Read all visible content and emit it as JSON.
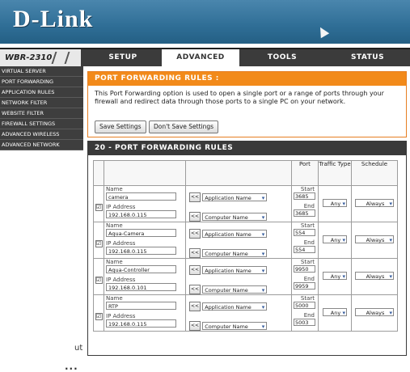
{
  "brand": {
    "logo": "D-Link"
  },
  "nav": {
    "model": "WBR-2310",
    "tabs": [
      {
        "label": "SETUP"
      },
      {
        "label": "ADVANCED"
      },
      {
        "label": "TOOLS"
      },
      {
        "label": "STATUS"
      }
    ],
    "active_tab": "ADVANCED"
  },
  "sidebar": {
    "items": [
      {
        "label": "Virtual Server"
      },
      {
        "label": "Port Forwarding"
      },
      {
        "label": "Application Rules"
      },
      {
        "label": "Network Filter"
      },
      {
        "label": "Website Filter"
      },
      {
        "label": "Firewall Settings"
      },
      {
        "label": "Advanced Wireless"
      },
      {
        "label": "Advanced Network"
      }
    ]
  },
  "fragments": {
    "text1": "ut",
    "text2": "..."
  },
  "intro": {
    "title": "PORT FORWARDING RULES :",
    "description": "This Port Forwarding option is used to open a single port or a range of ports through your firewall and redirect data through those ports to a single PC on your network.",
    "save_label": "Save Settings",
    "dont_save_label": "Don't Save Settings"
  },
  "rules": {
    "title": "20 - PORT FORWARDING RULES",
    "headers": {
      "port": "Port",
      "traffic": "Traffic Type",
      "schedule": "Schedule"
    },
    "labels": {
      "name": "Name",
      "ip": "IP Address",
      "start": "Start",
      "end": "End",
      "arrow": "<<"
    },
    "rows": [
      {
        "checked": "☑",
        "name": "camera",
        "ip": "192.168.0.115",
        "app": "Application Name",
        "computer": "Computer Name",
        "start": "3685",
        "end": "3685",
        "traffic": "Any",
        "schedule": "Always"
      },
      {
        "checked": "☑",
        "name": "Aqua-Camera",
        "ip": "192.168.0.115",
        "app": "Application Name",
        "computer": "Computer Name",
        "start": "554",
        "end": "554",
        "traffic": "Any",
        "schedule": "Always"
      },
      {
        "checked": "☑",
        "name": "Aqua-Controller",
        "ip": "192.168.0.101",
        "app": "Application Name",
        "computer": "Computer Name",
        "start": "9950",
        "end": "9959",
        "traffic": "Any",
        "schedule": "Always"
      },
      {
        "checked": "☑",
        "name": "RTP",
        "ip": "192.168.0.115",
        "app": "Application Name",
        "computer": "Computer Name",
        "start": "5000",
        "end": "5003",
        "traffic": "Any",
        "schedule": "Always"
      }
    ]
  }
}
